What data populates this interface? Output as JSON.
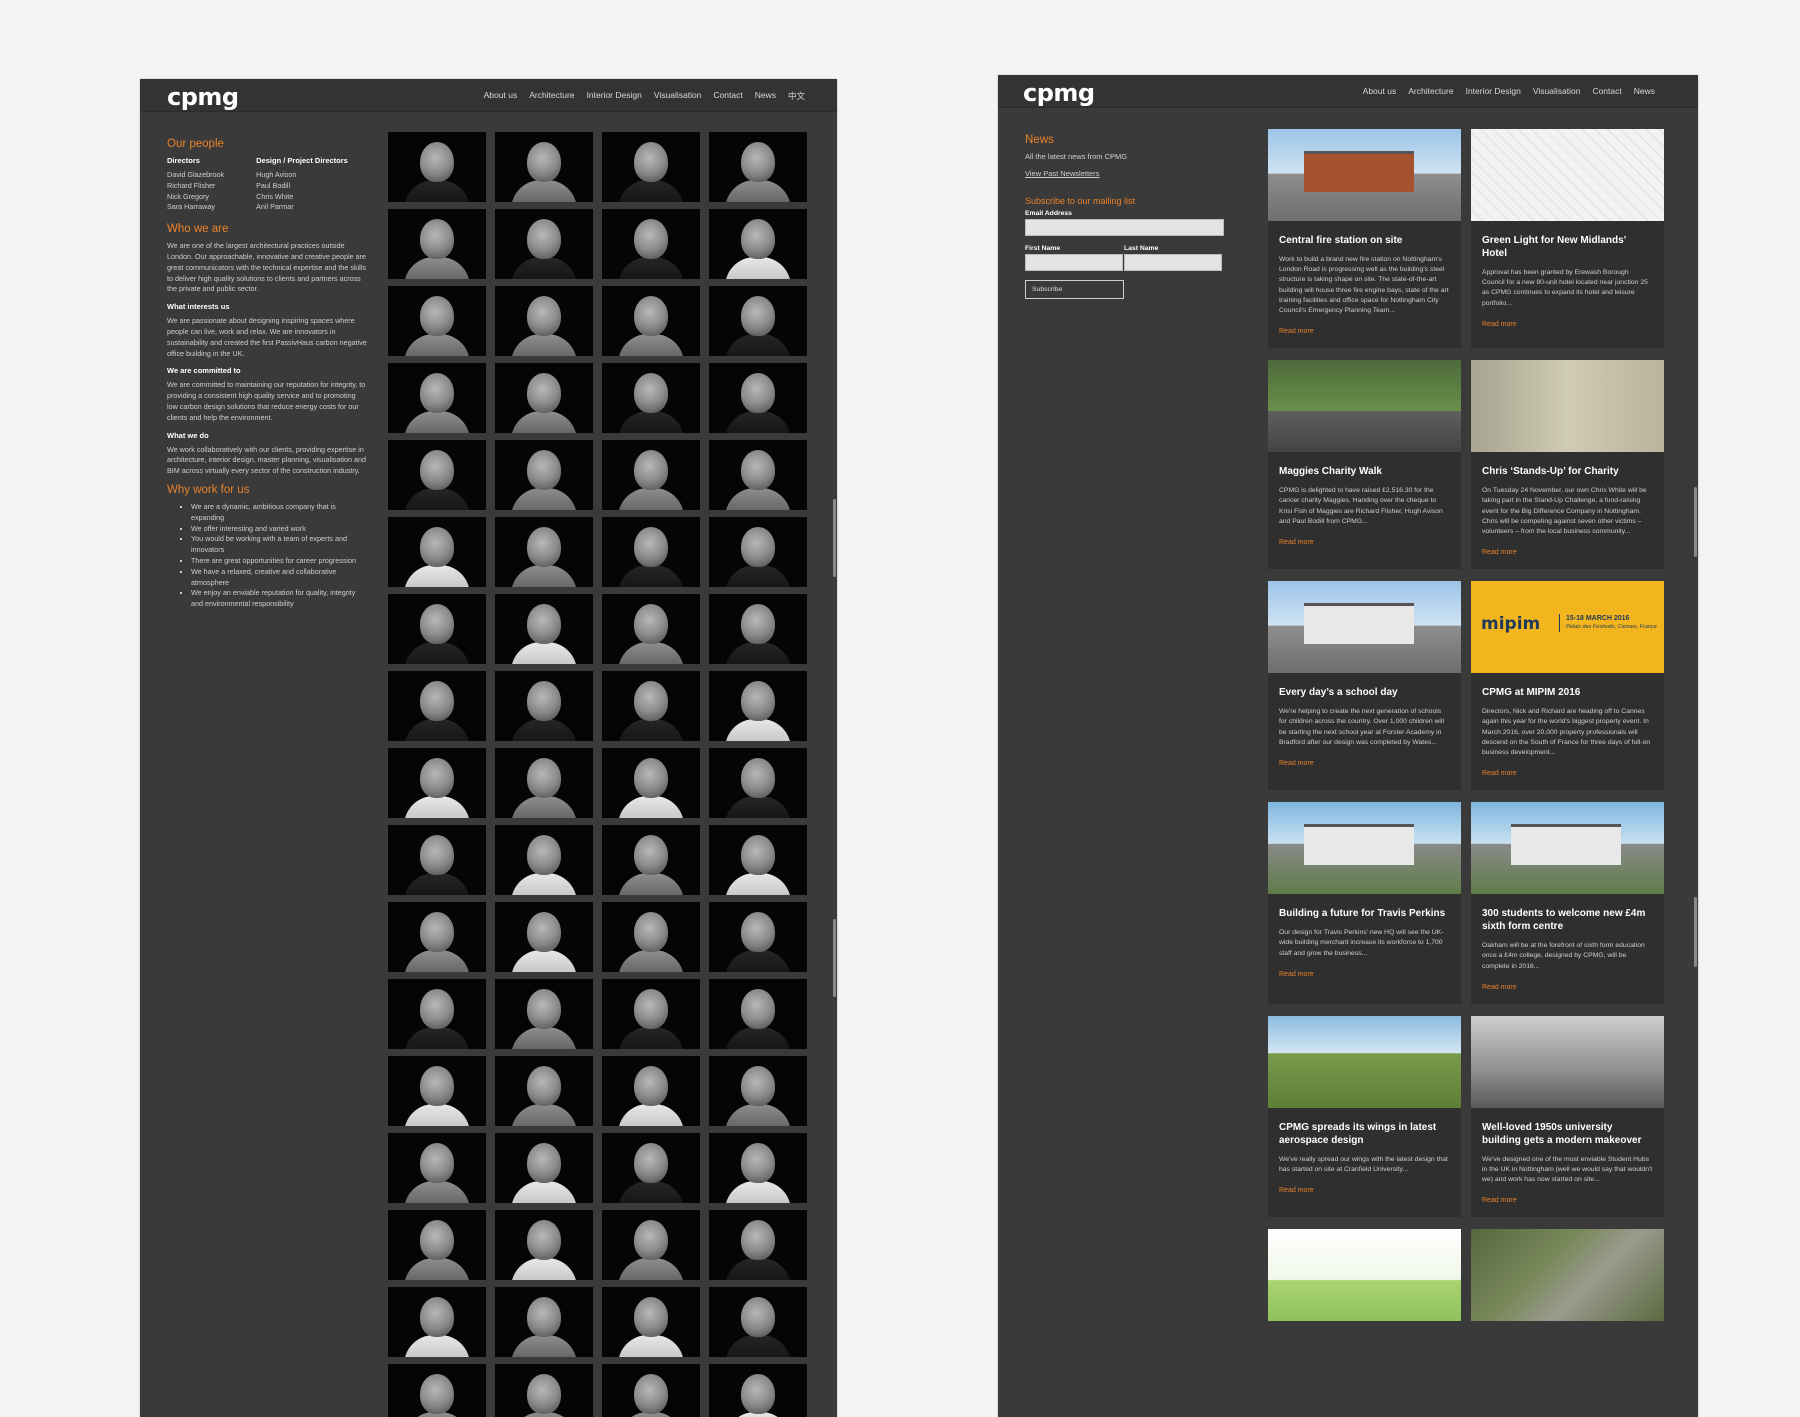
{
  "left": {
    "logo": "cpmg",
    "nav": [
      "About us",
      "Architecture",
      "Interior Design",
      "Visualisation",
      "Contact",
      "News",
      "中文"
    ],
    "our_people": {
      "title": "Our people",
      "directors_title": "Directors",
      "directors": [
        "David Glazebrook",
        "Richard Flisher",
        "Nick Gregory",
        "Sara Harraway"
      ],
      "project_directors_title": "Design / Project Directors",
      "project_directors": [
        "Hugh Avison",
        "Paul Bodill",
        "Chris White",
        "Anil Parmar"
      ]
    },
    "who_we_are": {
      "title": "Who we are",
      "text": "We are one of the largest architectural practices outside London. Our approachable, innovative and creative people are great communicators with the technical expertise and the skills to deliver high quality solutions to clients and partners across the private and public sector.",
      "interests_title": "What interests us",
      "interests_text": "We are passionate about designing inspiring spaces where people can live, work and relax. We are innovators in sustainability and created the first PassivHaus carbon negative office building in the UK.",
      "committed_title": "We are committed to",
      "committed_text": "We are committed to maintaining our reputation for integrity, to providing a consistent high quality service and to promoting low carbon design solutions that reduce energy costs for our clients and help the environment.",
      "do_title": "What we do",
      "do_text": "We work collaboratively with our clients, providing expertise in architecture, interior design, master planning, visualisation and BIM across virtually every sector of the construction industry."
    },
    "why_work": {
      "title": "Why work for us",
      "items": [
        "We are a dynamic, ambitious company that is expanding",
        "We offer interesting and varied work",
        "You would be working with a team of experts and innovators",
        "There are great opportunities for career progression",
        "We have a relaxed, creative and collaborative atmosphere",
        "We enjoy an enviable reputation for quality, integrity and environmental responsibility"
      ]
    },
    "photo_tones": [
      "dark",
      "mid",
      "dark",
      "mid",
      "mid",
      "dark",
      "dark",
      "light",
      "mid",
      "mid",
      "mid",
      "dark",
      "mid",
      "mid",
      "dark",
      "dark",
      "dark",
      "mid",
      "mid",
      "mid",
      "light",
      "mid",
      "dark",
      "dark",
      "dark",
      "light",
      "mid",
      "dark",
      "dark",
      "dark",
      "dark",
      "light",
      "light",
      "mid",
      "light",
      "dark",
      "dark",
      "light",
      "mid",
      "light",
      "mid",
      "light",
      "mid",
      "dark",
      "dark",
      "mid",
      "dark",
      "dark",
      "light",
      "mid",
      "light",
      "mid",
      "mid",
      "light",
      "dark",
      "light",
      "mid",
      "light",
      "mid",
      "dark",
      "light",
      "mid",
      "light",
      "dark",
      "mid",
      "mid",
      "mid",
      "light"
    ]
  },
  "right": {
    "logo": "cpmg",
    "nav": [
      "About us",
      "Architecture",
      "Interior Design",
      "Visualisation",
      "Contact",
      "News"
    ],
    "news_title": "News",
    "news_sub": "All the latest news from CPMG",
    "past_link": "View Past Newsletters",
    "subscribe_title": "Subscribe to our mailing list",
    "email_label": "Email Address",
    "first_label": "First Name",
    "last_label": "Last Name",
    "subscribe_btn": "Subscribe",
    "read_more": "Read more",
    "mipim": {
      "logo": "mipim",
      "date": "15-18 MARCH 2016",
      "venue": "Palais des Festivals, Cannes, France"
    },
    "cards": [
      {
        "title": "Central fire station on site",
        "img": "sky",
        "desc": "Work to build a brand new fire station on Nottingham's London Road is progressing well as the building's steel structure is taking shape on site. The state-of-the-art building will house three fire engine bays, state of the art training facilities and office space for Nottingham City Council's Emergency Planning Team..."
      },
      {
        "title": "Green Light for New Midlands’ Hotel",
        "img": "plan",
        "desc": "Approval has been granted by Erewash Borough Council for a new 80-unit hotel located near junction 25 as CPMG continues to expand its hotel and leisure portfolio..."
      },
      {
        "title": "Maggies Charity Walk",
        "img": "green",
        "desc": "CPMG is delighted to have raised £2,516.30 for the cancer charity Maggies. Handing over the cheque to Krisi Fish of Maggies are Richard Flisher, Hugh Avison and Paul Bodill from CPMG..."
      },
      {
        "title": "Chris ‘Stands-Up’ for Charity",
        "img": "stone",
        "desc": "On Tuesday 24 November, our own Chris White will be taking part in the Stand-Up Challenge, a fund-raising event for the Big Difference Company in Nottingham. Chris will be competing against seven other victims – volunteers – from the local business community..."
      },
      {
        "title": "Every day’s a school day",
        "img": "sky",
        "desc": "We're helping to create the next generation of schools for children across the country. Over 1,000 children will be starting the next school year at Forster Academy in Bradford after our design was completed by Wates..."
      },
      {
        "title": "CPMG at MIPIM 2016",
        "img": "mipim",
        "desc": "Directors, Nick and Richard are heading off to Cannes again this year for the world's biggest property event. In March 2016, over 20,000 property professionals will descend on the South of France for three days of full-on business development..."
      },
      {
        "title": "Building a future for Travis Perkins",
        "img": "render",
        "desc": "Our design for Travis Perkins' new HQ will see the UK-wide building merchant increase its workforce to 1,700 staff and grow the business..."
      },
      {
        "title": "300 students to welcome new £4m sixth form centre",
        "img": "render",
        "desc": "Oakham will be at the forefront of sixth form education once a £4m college, designed by CPMG, will be complete in 2016..."
      },
      {
        "title": "CPMG spreads its wings in latest aerospace design",
        "img": "site",
        "desc": "We've really spread our wings with the latest design that has started on site at Cranfield University..."
      },
      {
        "title": "Well-loved 1950s university building gets a modern makeover",
        "img": "interior",
        "desc": "We've designed one of the most enviable Student Hubs in the UK in Nottingham (well we would say that wouldn't we) and work has now started on site..."
      },
      {
        "title": "",
        "img": "sketch",
        "desc": ""
      },
      {
        "title": "",
        "img": "aerial",
        "desc": ""
      }
    ]
  }
}
